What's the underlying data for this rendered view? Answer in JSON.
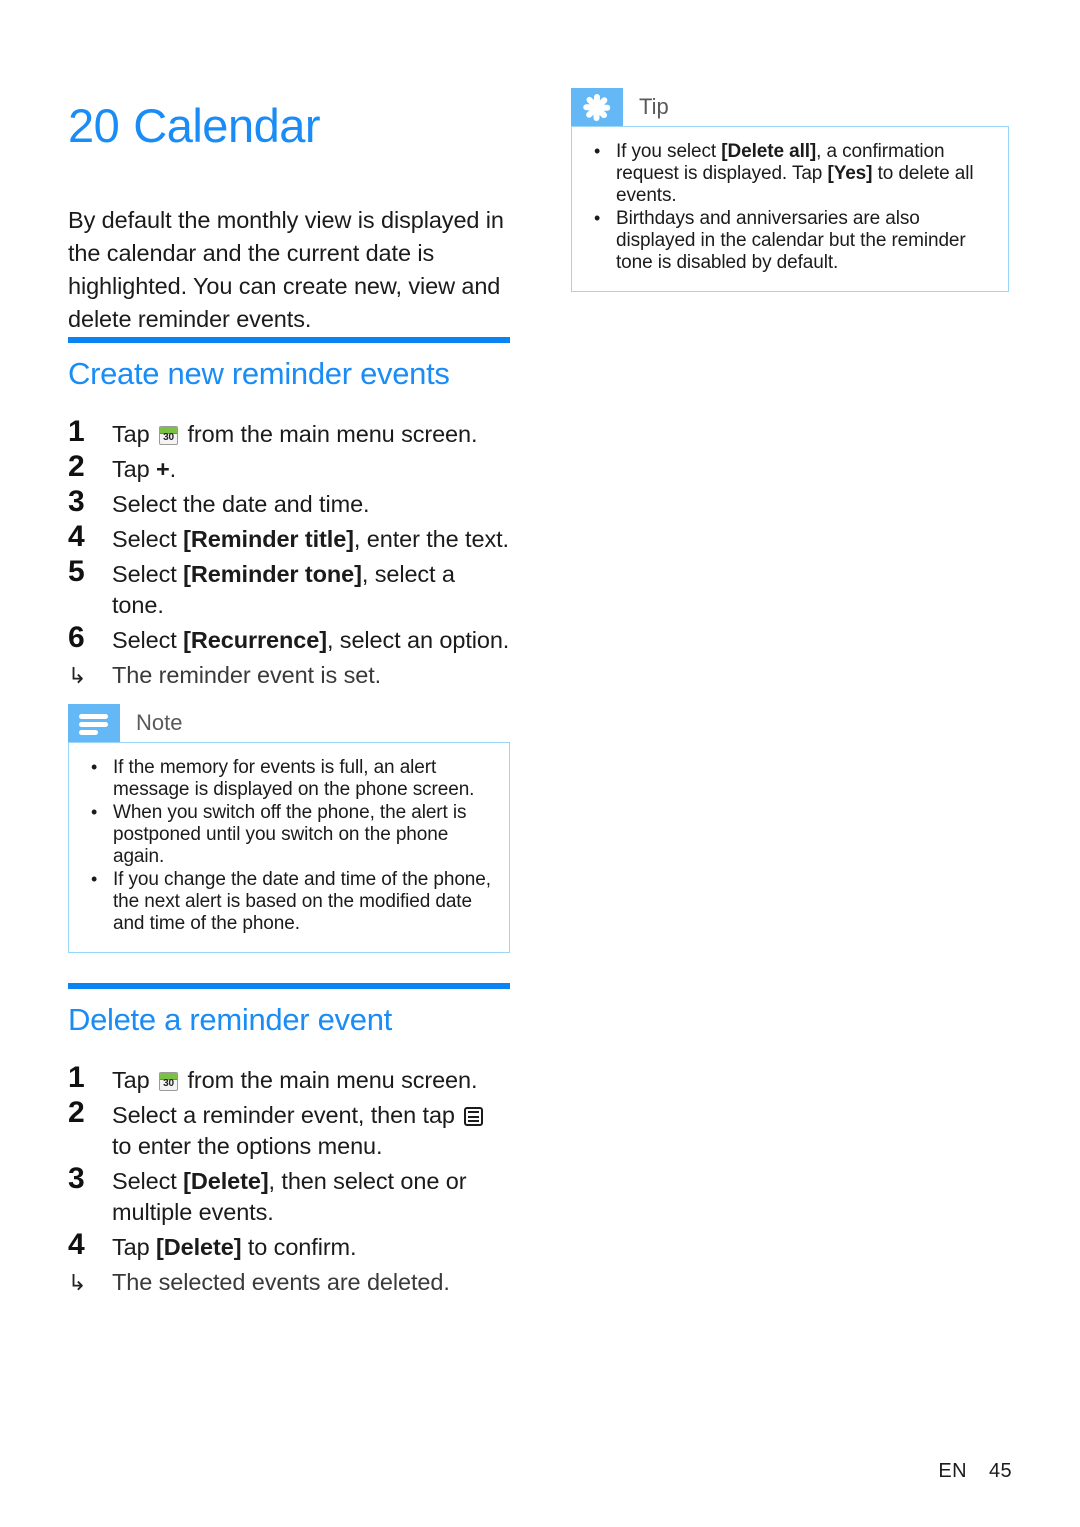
{
  "chapter": {
    "number": "20",
    "title": "Calendar",
    "intro": "By default the monthly view is displayed in the calendar and the current date is highlighted. You can create new, view and delete reminder events."
  },
  "tip": {
    "icon": "asterisk-icon",
    "label": "Tip",
    "items": [
      {
        "parts": [
          {
            "text": "If you select ",
            "bold": false
          },
          {
            "text": "[Delete all]",
            "bold": true
          },
          {
            "text": ", a confirmation request is displayed. Tap ",
            "bold": false
          },
          {
            "text": "[Yes]",
            "bold": true
          },
          {
            "text": " to delete all events.",
            "bold": false
          }
        ]
      },
      {
        "parts": [
          {
            "text": "Birthdays and anniversaries are also displayed in the calendar but the reminder tone is disabled by default.",
            "bold": false
          }
        ]
      }
    ]
  },
  "section_create": {
    "heading": "Create new reminder events",
    "steps": [
      {
        "number": "1",
        "parts": [
          {
            "text": "Tap ",
            "bold": false
          },
          {
            "icon": "calendar-30-icon"
          },
          {
            "text": " from the main menu screen.",
            "bold": false
          }
        ]
      },
      {
        "number": "2",
        "parts": [
          {
            "text": "Tap ",
            "bold": false
          },
          {
            "text": "+",
            "bold": true
          },
          {
            "text": ".",
            "bold": false
          }
        ]
      },
      {
        "number": "3",
        "parts": [
          {
            "text": "Select the date and time.",
            "bold": false
          }
        ]
      },
      {
        "number": "4",
        "parts": [
          {
            "text": "Select ",
            "bold": false
          },
          {
            "text": "[Reminder title]",
            "bold": true
          },
          {
            "text": ", enter the text.",
            "bold": false
          }
        ]
      },
      {
        "number": "5",
        "parts": [
          {
            "text": "Select ",
            "bold": false
          },
          {
            "text": "[Reminder tone]",
            "bold": true
          },
          {
            "text": ", select a tone.",
            "bold": false
          }
        ]
      },
      {
        "number": "6",
        "parts": [
          {
            "text": "Select ",
            "bold": false
          },
          {
            "text": "[Recurrence]",
            "bold": true
          },
          {
            "text": ", select an option.",
            "bold": false
          }
        ],
        "substep": "The reminder event is set."
      }
    ]
  },
  "note": {
    "icon": "note-lines-icon",
    "label": "Note",
    "items": [
      {
        "parts": [
          {
            "text": "If the memory for events is full, an alert message is displayed on the phone screen.",
            "bold": false
          }
        ]
      },
      {
        "parts": [
          {
            "text": "When you switch off the phone, the alert is postponed until you switch on the phone again.",
            "bold": false
          }
        ]
      },
      {
        "parts": [
          {
            "text": "If you change the date and time of the phone, the next alert is based on the modified date and time of the phone.",
            "bold": false
          }
        ]
      }
    ]
  },
  "section_delete": {
    "heading": "Delete a reminder event",
    "steps": [
      {
        "number": "1",
        "parts": [
          {
            "text": "Tap ",
            "bold": false
          },
          {
            "icon": "calendar-30-icon"
          },
          {
            "text": " from the main menu screen.",
            "bold": false
          }
        ]
      },
      {
        "number": "2",
        "parts": [
          {
            "text": "Select a reminder event, then tap ",
            "bold": false
          },
          {
            "icon": "options-menu-icon"
          },
          {
            "text": " to enter the options menu.",
            "bold": false
          }
        ]
      },
      {
        "number": "3",
        "parts": [
          {
            "text": "Select ",
            "bold": false
          },
          {
            "text": "[Delete]",
            "bold": true
          },
          {
            "text": ", then select one or multiple events.",
            "bold": false
          }
        ]
      },
      {
        "number": "4",
        "parts": [
          {
            "text": "Tap ",
            "bold": false
          },
          {
            "text": "[Delete]",
            "bold": true
          },
          {
            "text": " to confirm.",
            "bold": false
          }
        ],
        "substep": "The selected events are deleted."
      }
    ]
  },
  "icons": {
    "calendar_day_number": "30",
    "substep_arrow": "↳"
  },
  "footer": {
    "language": "EN",
    "page_number": "45"
  },
  "colors": {
    "heading_blue": "#1a8cf5",
    "rule_blue": "#0b84f3",
    "callout_badge_blue": "#63b8f5",
    "callout_border_blue": "#9ad6f7",
    "calendar_icon_green": "#7cc242"
  }
}
